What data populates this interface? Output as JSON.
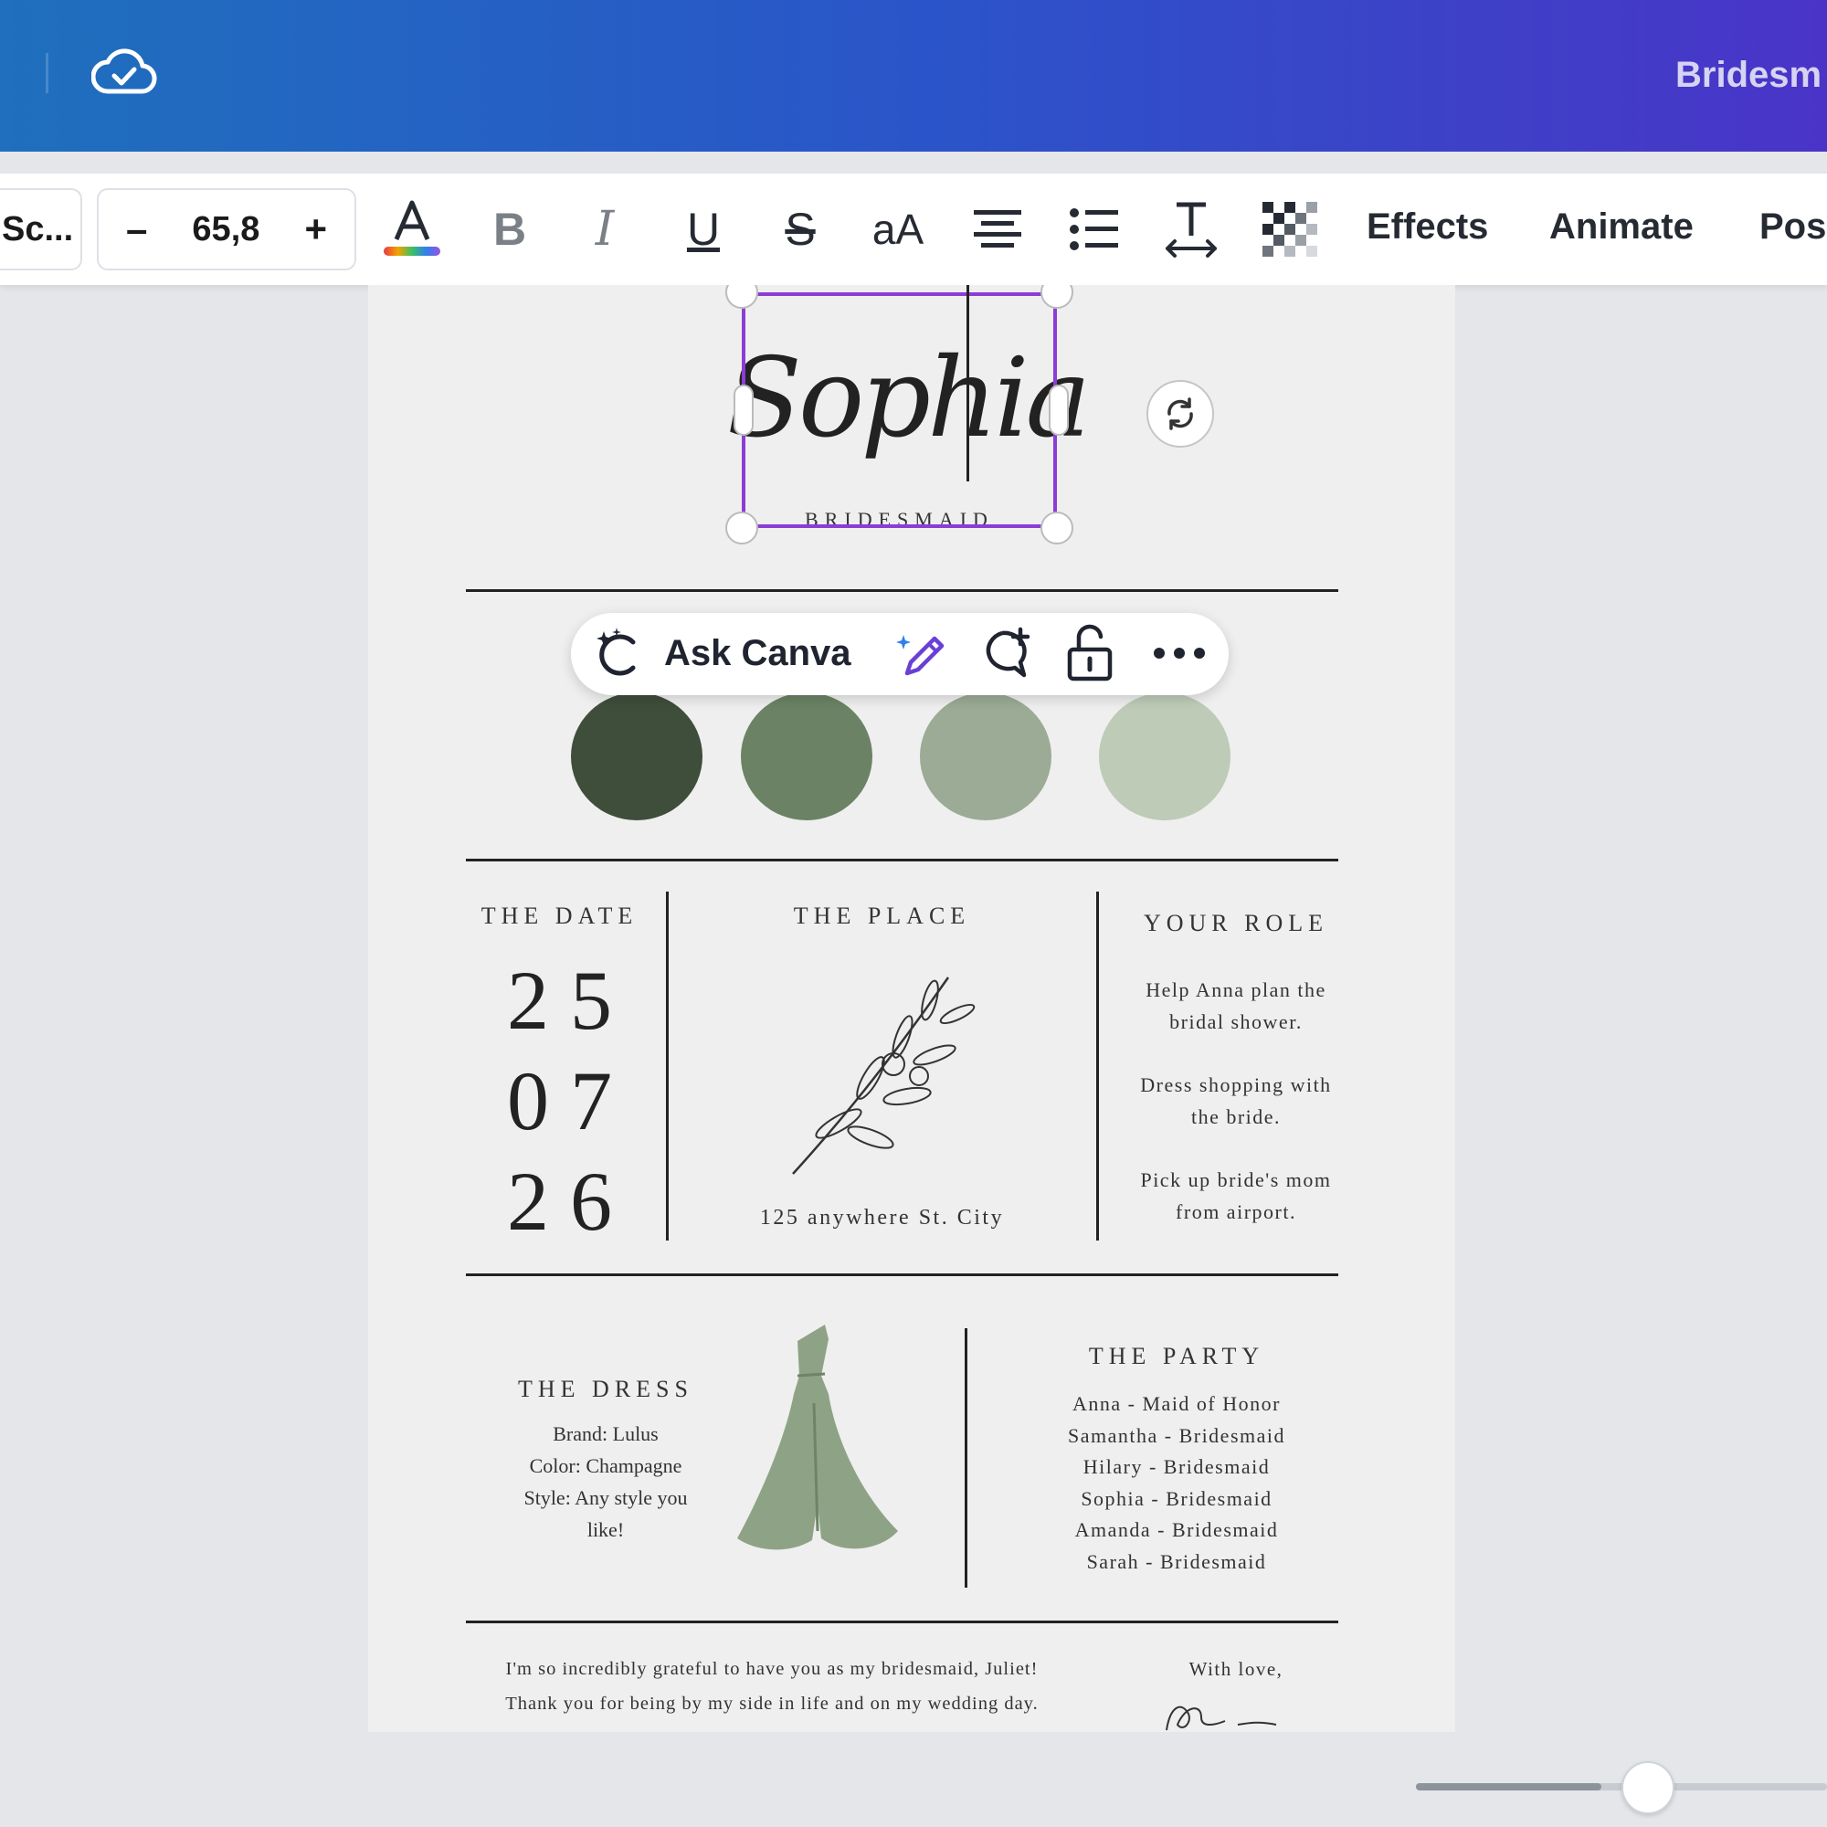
{
  "topbar": {
    "document_title": "Bridesm",
    "sync_icon": "cloud-check-icon"
  },
  "toolbar": {
    "font_name": "Sc...",
    "font_size": "65,8",
    "decrease_label": "–",
    "increase_label": "+",
    "bold_label": "B",
    "italic_label": "I",
    "underline_label": "U",
    "strike_label": "S",
    "case_label": "aA",
    "effects_label": "Effects",
    "animate_label": "Animate",
    "position_label": "Pos"
  },
  "ask_canva": {
    "label": "Ask Canva"
  },
  "design": {
    "name": "Sophia",
    "subtitle": "BRIDESMAID",
    "palette": [
      "#3f4d3b",
      "#6b8364",
      "#9bab95",
      "#bdcbb7"
    ],
    "date": {
      "heading": "THE DATE",
      "day": "2 5",
      "month": "0 7",
      "year": "2 6"
    },
    "place": {
      "heading": "THE PLACE",
      "address": "125 anywhere St. City"
    },
    "role": {
      "heading": "YOUR ROLE",
      "items": [
        [
          "Help Anna plan the",
          "bridal shower."
        ],
        [
          "Dress shopping with",
          "the bride."
        ],
        [
          "Pick up bride's mom",
          "from airport."
        ]
      ]
    },
    "dress": {
      "heading": "THE DRESS",
      "lines": [
        "Brand: Lulus",
        "Color: Champagne",
        "Style: Any style you",
        "like!"
      ],
      "dress_color": "#8ea386"
    },
    "party": {
      "heading": "THE PARTY",
      "members": [
        "Anna - Maid of Honor",
        "Samantha - Bridesmaid",
        "Hilary - Bridesmaid",
        "Sophia - Bridesmaid",
        "Amanda - Bridesmaid",
        "Sarah - Bridesmaid"
      ]
    },
    "note": {
      "line1": "I'm so incredibly grateful to have you as my bridesmaid, Juliet!",
      "line2": "Thank you for being by my side in life and on my wedding day.",
      "closing": "With love,"
    }
  },
  "zoom": {
    "level": 0.45
  }
}
